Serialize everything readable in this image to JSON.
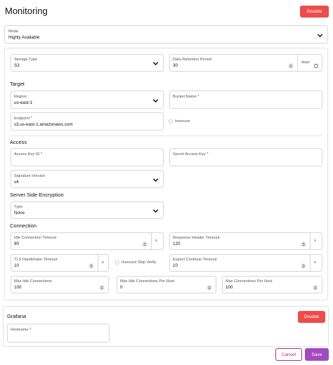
{
  "header": {
    "title": "Monitoring",
    "disable_label": "Disable"
  },
  "mode": {
    "label": "Mode",
    "value": "Highly Available"
  },
  "storage": {
    "storage_type_label": "Storage Type",
    "storage_type_value": "S3",
    "retention_label": "Data Retention Period",
    "retention_value": "30",
    "retention_unit": "days"
  },
  "target": {
    "heading": "Target",
    "region_label": "Region",
    "region_value": "us-east-1",
    "bucket_label": "Bucket Name",
    "bucket_req": "*",
    "endpoint_label": "Endpoint",
    "endpoint_req": "*",
    "endpoint_value": "s3.us-east-1.amazonaws.com",
    "insecure_label": "Insecure"
  },
  "access": {
    "heading": "Access",
    "key_id_label": "Access Key ID",
    "key_id_req": "*",
    "secret_label": "Secret Access Key",
    "secret_req": "*",
    "sigver_label": "Signature Version",
    "sigver_value": "v4"
  },
  "sse": {
    "heading": "Server Side Encryption",
    "type_label": "Type",
    "type_value": "None"
  },
  "connection": {
    "heading": "Connection",
    "idle_timeout_label": "Idle Connection Timeout",
    "idle_timeout_value": "90",
    "idle_timeout_unit": "s",
    "resp_header_label": "Response Header Timeout",
    "resp_header_value": "120",
    "resp_header_unit": "s",
    "tls_label": "TLS Handshake Timeout",
    "tls_value": "10",
    "tls_unit": "s",
    "insecure_skip_label": "Insecure Skip Verify",
    "expect_label": "Expect Continue Timeout",
    "expect_value": "10",
    "expect_unit": "s",
    "max_idle_label": "Max Idle Connections",
    "max_idle_value": "100",
    "max_idle_host_label": "Max Idle Connections Per Host",
    "max_idle_host_value": "0",
    "max_conn_host_label": "Max Connections Per Host",
    "max_conn_host_value": "100"
  },
  "grafana": {
    "heading": "Grafana",
    "disable_label": "Disable",
    "hostname_label": "Hostname",
    "hostname_req": "*"
  },
  "footer": {
    "cancel_label": "Cancel",
    "save_label": "Save"
  },
  "colors": {
    "danger": "#ee4b4b",
    "save": "#a24bbf",
    "cancel_border": "#b0306e"
  },
  "icons": {
    "dropdown": "chevron-down-icon",
    "stepper": "stepper-icon",
    "refresh": "refresh-icon"
  }
}
